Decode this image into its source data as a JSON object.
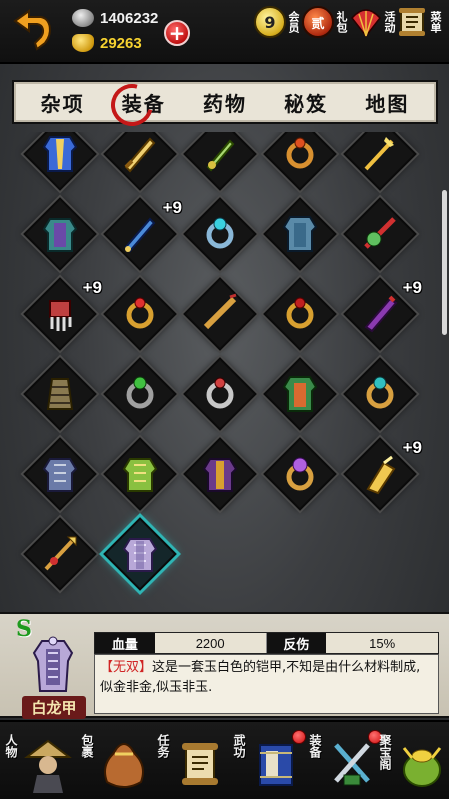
{
  "currency": {
    "silver": "1406232",
    "gold": "29263"
  },
  "top_menu": [
    {
      "id": "vip",
      "label": "会员",
      "badge": "9"
    },
    {
      "id": "gift",
      "label": "礼包",
      "badge": "贰"
    },
    {
      "id": "events",
      "label": "活动"
    },
    {
      "id": "menu",
      "label": "菜单"
    }
  ],
  "tabs": [
    {
      "label": "杂项",
      "active": false
    },
    {
      "label": "装备",
      "active": true
    },
    {
      "label": "药物",
      "active": false
    },
    {
      "label": "秘笈",
      "active": false
    },
    {
      "label": "地图",
      "active": false
    }
  ],
  "items": [
    {
      "icon": "blue-robe-icon",
      "plus": ""
    },
    {
      "icon": "golden-blade-icon",
      "plus": ""
    },
    {
      "icon": "jade-dagger-icon",
      "plus": ""
    },
    {
      "icon": "amber-ring-icon",
      "plus": ""
    },
    {
      "icon": "golden-trident-icon",
      "plus": ""
    },
    {
      "icon": "teal-armor-icon",
      "plus": ""
    },
    {
      "icon": "blue-sword-icon",
      "plus": "+9"
    },
    {
      "icon": "sapphire-ring-icon",
      "plus": ""
    },
    {
      "icon": "blue-robe-2-icon",
      "plus": ""
    },
    {
      "icon": "jade-wand-icon",
      "plus": ""
    },
    {
      "icon": "claw-glove-icon",
      "plus": "+9"
    },
    {
      "icon": "ruby-ring-icon",
      "plus": ""
    },
    {
      "icon": "golden-flute-icon",
      "plus": ""
    },
    {
      "icon": "ruby-ring-2-icon",
      "plus": ""
    },
    {
      "icon": "purple-blade-icon",
      "plus": "+9"
    },
    {
      "icon": "bracer-icon",
      "plus": ""
    },
    {
      "icon": "emerald-ring-icon",
      "plus": ""
    },
    {
      "icon": "silver-ring-icon",
      "plus": ""
    },
    {
      "icon": "green-robe-icon",
      "plus": ""
    },
    {
      "icon": "turquoise-ring-icon",
      "plus": ""
    },
    {
      "icon": "grey-armor-icon",
      "plus": ""
    },
    {
      "icon": "green-armor-icon",
      "plus": ""
    },
    {
      "icon": "purple-robe-icon",
      "plus": ""
    },
    {
      "icon": "amethyst-ring-icon",
      "plus": ""
    },
    {
      "icon": "golden-gauntlet-icon",
      "plus": "+9"
    },
    {
      "icon": "golden-spear-icon",
      "plus": ""
    },
    {
      "icon": "white-dragon-armor-icon",
      "plus": "",
      "selected": true
    }
  ],
  "detail": {
    "grade": "S",
    "name": "白龙甲",
    "stat1_label": "血量",
    "stat1_value": "2200",
    "stat2_label": "反伤",
    "stat2_value": "15%",
    "tag": "【无双】",
    "description": "这是一套玉白色的铠甲,不知是由什么材料制成,似金非金,似玉非玉."
  },
  "bottom_nav": [
    {
      "id": "character",
      "label": "人物",
      "alert": false
    },
    {
      "id": "bag",
      "label": "包裹",
      "alert": false
    },
    {
      "id": "quest",
      "label": "任务",
      "alert": false
    },
    {
      "id": "martial",
      "label": "武功",
      "alert": true
    },
    {
      "id": "equip",
      "label": "装备",
      "alert": true
    },
    {
      "id": "treasure",
      "label": "聚宝阁",
      "alert": false
    }
  ]
}
